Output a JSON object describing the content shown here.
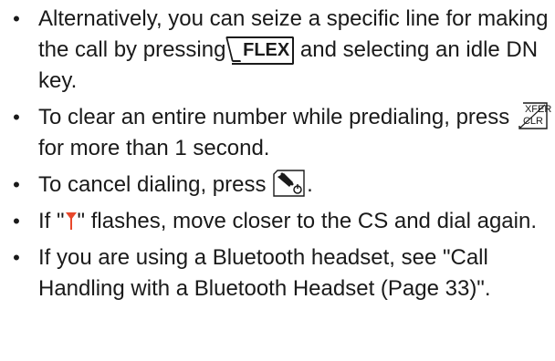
{
  "notes": [
    {
      "part1": "Alternatively, you can seize a specific line for making the call by pressing",
      "key": "FLEX",
      "part2": "and selecting an idle DN key."
    },
    {
      "part1": "To clear an entire number while predialing, press",
      "key_top": "XFER",
      "key_bottom": "CLR",
      "part2": "for more than 1 second."
    },
    {
      "part1": "To cancel dialing, press",
      "key_icon": "off-hook-power-icon",
      "part2": "."
    },
    {
      "part1": "If \"",
      "icon": "antenna-icon",
      "part2": "\" flashes, move closer to the CS and dial again."
    },
    {
      "text": "If you are using a Bluetooth headset, see \"Call Handling with a Bluetooth Headset (Page 33)\"."
    }
  ],
  "bullet": "•",
  "colors": {
    "text": "#1a1a1a",
    "antenna_icon": "#e8482c"
  }
}
